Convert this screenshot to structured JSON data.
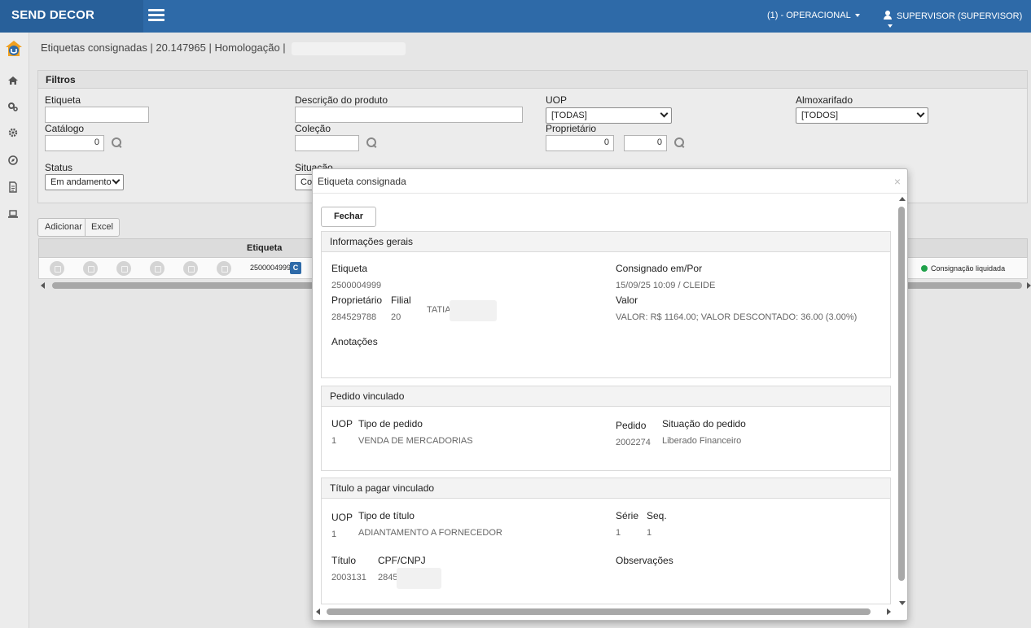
{
  "app": {
    "brand": "SEND DECOR",
    "operation_menu": "(1) - OPERACIONAL",
    "user_menu": "SUPERVISOR (SUPERVISOR)"
  },
  "sidebar": {
    "items": [
      "home-icon",
      "cogs-icon",
      "gear-icon",
      "compass-icon",
      "document-icon",
      "laptop-icon"
    ]
  },
  "breadcrumb": "Etiquetas consignadas | 20.147965 | Homologação |",
  "filters": {
    "title": "Filtros",
    "etiqueta_label": "Etiqueta",
    "etiqueta_value": "",
    "descricao_label": "Descrição do produto",
    "descricao_value": "",
    "uop_label": "UOP",
    "uop_value": "[TODAS]",
    "almoxarifado_label": "Almoxarifado",
    "almoxarifado_value": "[TODOS]",
    "catalogo_label": "Catálogo",
    "catalogo_value": "0",
    "colecao_label": "Coleção",
    "colecao_value": "",
    "proprietario_label": "Proprietário",
    "proprietario_value_1": "0",
    "proprietario_value_2": "0",
    "status_label": "Status",
    "status_value": "Em andamento",
    "situacao_label": "Situação",
    "situacao_value": "Co"
  },
  "toolbar": {
    "add_label": "Adicionar",
    "excel_label": "Excel"
  },
  "grid": {
    "column_etiqueta": "Etiqueta",
    "rows": [
      {
        "etiqueta": "2500004999",
        "badge": "C",
        "status": "Consignação liquidada",
        "status_color": "#1fa14a"
      }
    ]
  },
  "modal": {
    "title": "Etiqueta consignada",
    "close_label": "×",
    "fechar_label": "Fechar",
    "info": {
      "title": "Informações gerais",
      "etiqueta_label": "Etiqueta",
      "etiqueta_value": "2500004999",
      "consignado_label": "Consignado em/Por",
      "consignado_value": "15/09/25 10:09 / CLEIDE",
      "proprietario_label": "Proprietário",
      "proprietario_value": "284529788",
      "filial_label": "Filial",
      "filial_value": "20",
      "nome_value": "TATIA",
      "valor_label": "Valor",
      "valor_value": "VALOR: R$ 1164.00; VALOR DESCONTADO: 36.00 (3.00%)",
      "anotacoes_label": "Anotações"
    },
    "pedido": {
      "title": "Pedido vinculado",
      "uop_label": "UOP",
      "uop_value": "1",
      "tipo_label": "Tipo de pedido",
      "tipo_value": "VENDA DE MERCADORIAS",
      "pedido_label": "Pedido",
      "pedido_value": "2002274",
      "situacao_label": "Situação do pedido",
      "situacao_value": "Liberado Financeiro"
    },
    "titulo": {
      "title": "Título a pagar vinculado",
      "uop_label": "UOP",
      "uop_value": "1",
      "tipo_label": "Tipo de título",
      "tipo_value": "ADIANTAMENTO A FORNECEDOR",
      "serie_label": "Série",
      "serie_value": "1",
      "seq_label": "Seq.",
      "seq_value": "1",
      "titulo_label": "Título",
      "titulo_value": "2003131",
      "cpf_label": "CPF/CNPJ",
      "cpf_value": "2845",
      "observacoes_label": "Observações"
    }
  }
}
